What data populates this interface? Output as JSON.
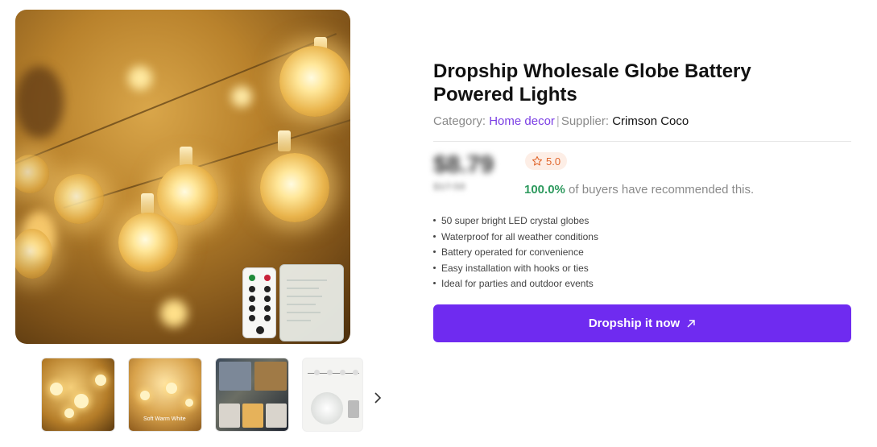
{
  "gallery": {
    "main_image_alt": "Globe string lights with remote and battery box",
    "thumbnails": [
      {
        "name": "thumbnail-globe-lights-closeup",
        "caption": ""
      },
      {
        "name": "thumbnail-warm-lights",
        "caption": "Soft Warm White"
      },
      {
        "name": "thumbnail-outdoor-scenes",
        "caption": ""
      },
      {
        "name": "thumbnail-product-diagram",
        "caption": ""
      }
    ],
    "next_icon": "chevron-right-icon"
  },
  "product": {
    "title": "Dropship Wholesale Globe Battery Powered Lights",
    "category_label": "Category:",
    "category_value": "Home decor",
    "separator": "|",
    "supplier_label": "Supplier:",
    "supplier_value": "Crimson Coco",
    "price": "$8.79",
    "old_price": "$17.58",
    "rating": "5.0",
    "rating_icon": "star-outline-icon",
    "recommend_pct": "100.0%",
    "recommend_text": "of buyers have recommended this.",
    "features": [
      "50 super bright LED crystal globes",
      "Waterproof for all weather conditions",
      "Battery operated for convenience",
      "Easy installation with hooks or ties",
      "Ideal for parties and outdoor events"
    ],
    "cta_label": "Dropship it now",
    "cta_icon": "arrow-up-right-icon"
  },
  "colors": {
    "accent": "#6f2bf0",
    "link": "#7b3fe4",
    "positive": "#2e9a5e",
    "rating": "#e0662c",
    "rating_bg": "#fdeee6"
  }
}
